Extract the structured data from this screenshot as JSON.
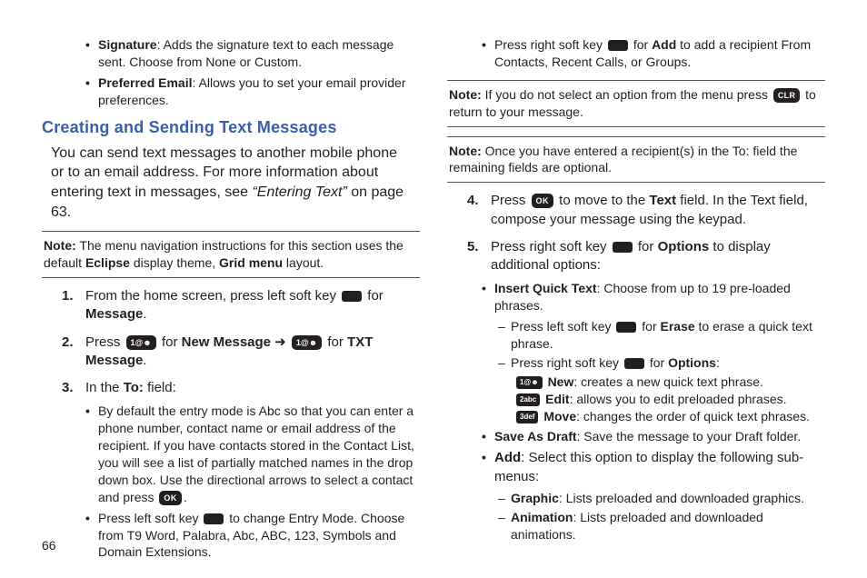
{
  "pageNumber": "66",
  "left": {
    "bullets_top": [
      {
        "label": "Signature",
        "text": ": Adds the signature text to each message sent. Choose from None or Custom."
      },
      {
        "label": "Preferred Email",
        "text": ": Allows you to set your email provider preferences."
      }
    ],
    "heading": "Creating and Sending Text Messages",
    "intro1": "You can send text messages to another mobile phone or to an email address. For more information about entering text in messages, see ",
    "intro_italic": "“Entering Text”",
    "intro2": " on page 63.",
    "note_label": "Note:",
    "note_text1": " The menu navigation instructions for this section uses the default ",
    "note_bold1": "Eclipse",
    "note_text2": " display theme, ",
    "note_bold2": "Grid menu",
    "note_text3": " layout.",
    "step1_a": "From the home screen, press left soft key ",
    "step1_b": " for ",
    "step1_c": "Message",
    "step1_d": ".",
    "step2_a": "Press ",
    "step2_b": " for ",
    "step2_c": "New Message",
    "step2_arrow": " ➜ ",
    "step2_d": " for ",
    "step2_e": "TXT Message",
    "step2_f": ".",
    "step3_a": "In the ",
    "step3_b": "To:",
    "step3_c": " field:",
    "step3_bullet1_a": "By default the entry mode is Abc so that you can enter a phone number, contact name or email address of the recipient. If you have contacts stored in the Contact List, you will see a list of partially matched names in the drop down box. Use the directional arrows to select a contact and press ",
    "step3_bullet1_b": ".",
    "step3_bullet2_a": "Press left soft key ",
    "step3_bullet2_b": " to change Entry Mode. Choose from T9 Word, Palabra, Abc, ABC, 123, Symbols and Domain Extensions.",
    "key1": "1@☻",
    "ok": "OK"
  },
  "right": {
    "top_bullet_a": "Press right soft key ",
    "top_bullet_b": " for ",
    "top_bullet_c": "Add",
    "top_bullet_d": " to add a recipient From Contacts, Recent Calls, or Groups.",
    "note1_label": "Note:",
    "note1_a": " If you do not select an option from the menu press ",
    "note1_b": " to return to your message.",
    "clr": "CLR",
    "note2_label": "Note:",
    "note2_text": " Once you have entered a recipient(s) in the To: field the remaining fields are optional.",
    "step4_a": "Press ",
    "step4_b": " to move to the ",
    "step4_c": "Text",
    "step4_d": " field. In the Text field, compose your message using the keypad.",
    "ok": "OK",
    "step5_a": "Press right soft key ",
    "step5_b": " for ",
    "step5_c": "Options",
    "step5_d": " to display additional options:",
    "iq_label": "Insert Quick Text",
    "iq_text": ": Choose from up to 19 pre-loaded phrases.",
    "iq_sub1_a": "Press left soft key ",
    "iq_sub1_b": " for ",
    "iq_sub1_c": "Erase",
    "iq_sub1_d": " to erase a quick text phrase.",
    "iq_sub2_a": "Press right soft key ",
    "iq_sub2_b": " for ",
    "iq_sub2_c": "Options",
    "iq_sub2_d": ":",
    "key_new": "1@☻",
    "key_edit": "2abc",
    "key_move": "3def",
    "new_label": "New",
    "new_text": ": creates a new quick text phrase.",
    "edit_label": "Edit",
    "edit_text": ": allows you to edit preloaded phrases.",
    "move_label": "Move",
    "move_text": ": changes the order of quick text phrases.",
    "save_label": "Save As Draft",
    "save_text": ": Save the message to your Draft folder.",
    "add_label": "Add",
    "add_text": ": Select this option to display the following sub-menus:",
    "graphic_label": "Graphic",
    "graphic_text": ": Lists preloaded and downloaded graphics.",
    "anim_label": "Animation",
    "anim_text": ": Lists preloaded and downloaded animations."
  }
}
